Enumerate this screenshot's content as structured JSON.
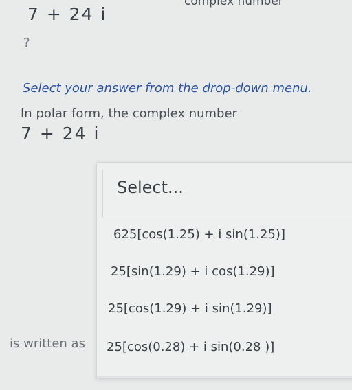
{
  "header": {
    "cut_text": "complex number",
    "expression": "7 + 24 i"
  },
  "question_mark": "?",
  "question": {
    "instruction": "Select your answer from the drop-down menu.",
    "prompt": "In polar form, the complex number",
    "expression": "7 + 24 i",
    "suffix": "is written as"
  },
  "dropdown": {
    "placeholder": "Select...",
    "options": [
      "625[cos(1.25) + i sin(1.25)]",
      "25[sin(1.29) + i cos(1.29)]",
      "25[cos(1.29) + i sin(1.29)]",
      "25[cos(0.28) + i sin(0.28 )]"
    ]
  }
}
